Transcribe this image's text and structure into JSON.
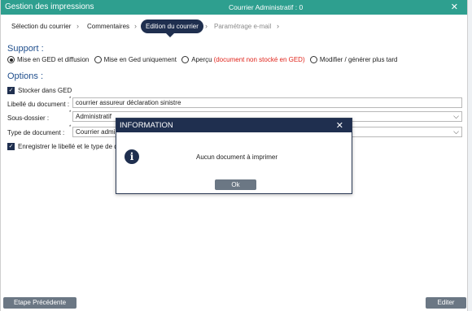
{
  "window": {
    "title": "Gestion des impressions",
    "subtitle": "Courrier Administratif : 0",
    "close_glyph": "✕"
  },
  "steps": [
    {
      "label": "Sélection du courrier",
      "state": "done"
    },
    {
      "label": "Commentaires",
      "state": "done"
    },
    {
      "label": "Edition du courrier",
      "state": "active"
    },
    {
      "label": "Paramétrage e-mail",
      "state": "disabled"
    }
  ],
  "chevron_glyph": "›",
  "support": {
    "heading": "Support :",
    "options": [
      {
        "label": "Mise en GED et diffusion",
        "selected": true
      },
      {
        "label": "Mise en Ged uniquement",
        "selected": false
      },
      {
        "label": "Aperçu",
        "note": "(document non stocké en GED)",
        "selected": false
      },
      {
        "label": "Modifier / générer plus tard",
        "selected": false
      }
    ]
  },
  "options": {
    "heading": "Options :",
    "store_ged": {
      "label": "Stocker dans GED",
      "checked": true
    },
    "libelle": {
      "label": "Libellé du document :",
      "value": "courrier assureur déclaration sinistre"
    },
    "sous_dossier": {
      "label": "Sous-dossier :",
      "value": "Administratif"
    },
    "type_document": {
      "label": "Type de document :",
      "value": "Courrier admi"
    },
    "save_label": {
      "label": "Enregistrer le libellé et le type de d",
      "checked": true
    },
    "required_mark": "*"
  },
  "footer": {
    "prev_label": "Etape Précédente",
    "edit_label": "Editer"
  },
  "dialog": {
    "title": "INFORMATION",
    "close_glyph": "✕",
    "icon_glyph": "i",
    "message": "Aucun document à imprimer",
    "ok_label": "Ok"
  },
  "colors": {
    "titlebar": "#2e9f8f",
    "navy": "#1f2f4f",
    "section_heading": "#1f4e8c",
    "warning_red": "#e0241b",
    "button_gray": "#6b7784"
  },
  "icons": {
    "dropdown": "chevron-down-icon",
    "info": "info-icon",
    "close": "close-icon"
  }
}
